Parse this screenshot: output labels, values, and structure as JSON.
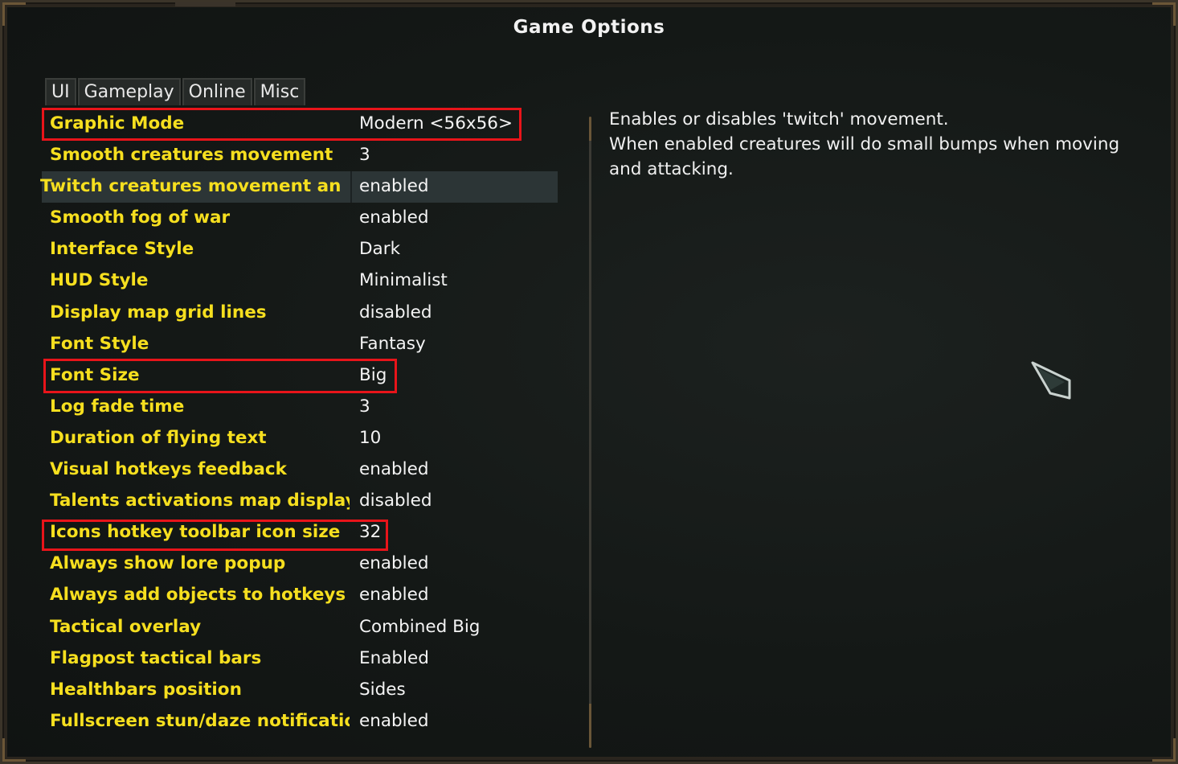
{
  "window": {
    "title": "Game Options"
  },
  "tabs": [
    {
      "label": "UI"
    },
    {
      "label": "Gameplay"
    },
    {
      "label": "Online"
    },
    {
      "label": "Misc"
    }
  ],
  "options": [
    {
      "label": "Graphic Mode",
      "value": "Modern <56x56>"
    },
    {
      "label": "Smooth creatures movement",
      "value": "3"
    },
    {
      "label": "Twitch creatures movement and attack",
      "value": "enabled"
    },
    {
      "label": "Smooth fog of war",
      "value": "enabled"
    },
    {
      "label": "Interface Style",
      "value": "Dark"
    },
    {
      "label": "HUD Style",
      "value": "Minimalist"
    },
    {
      "label": "Display map grid lines",
      "value": "disabled"
    },
    {
      "label": "Font Style",
      "value": "Fantasy"
    },
    {
      "label": "Font Size",
      "value": "Big"
    },
    {
      "label": "Log fade time",
      "value": "3"
    },
    {
      "label": "Duration of flying text",
      "value": "10"
    },
    {
      "label": "Visual hotkeys feedback",
      "value": "enabled"
    },
    {
      "label": "Talents activations map display",
      "value": "disabled"
    },
    {
      "label": "Icons hotkey toolbar icon size",
      "value": "32"
    },
    {
      "label": "Always show lore popup",
      "value": "enabled"
    },
    {
      "label": "Always add objects to hotkeys",
      "value": "enabled"
    },
    {
      "label": "Tactical overlay",
      "value": "Combined Big"
    },
    {
      "label": "Flagpost tactical bars",
      "value": "Enabled"
    },
    {
      "label": "Healthbars position",
      "value": "Sides"
    },
    {
      "label": "Fullscreen stun/daze notification",
      "value": "enabled"
    }
  ],
  "description": {
    "lines": [
      "Enables or disables 'twitch' movement.",
      "When enabled creatures will do small bumps when moving",
      "and attacking."
    ]
  },
  "colors": {
    "label": "#f6df1f",
    "value": "#f4f4f4",
    "highlight": "#e8141a",
    "selected_row": "#2c3536"
  },
  "icons": {
    "cursor": "game-cursor-icon"
  }
}
